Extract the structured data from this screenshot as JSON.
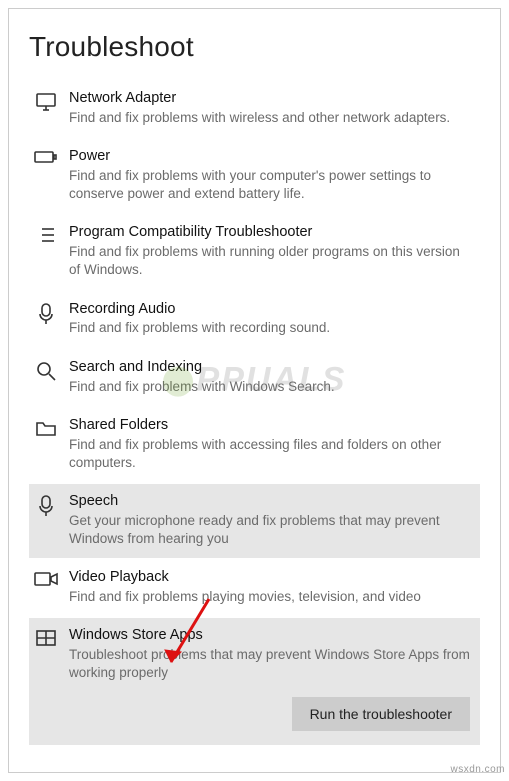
{
  "page": {
    "title": "Troubleshoot"
  },
  "items": [
    {
      "title": "Network Adapter",
      "desc": "Find and fix problems with wireless and other network adapters.",
      "icon": "monitor",
      "state": "normal"
    },
    {
      "title": "Power",
      "desc": "Find and fix problems with your computer's power settings to conserve power and extend battery life.",
      "icon": "battery",
      "state": "normal"
    },
    {
      "title": "Program Compatibility Troubleshooter",
      "desc": "Find and fix problems with running older programs on this version of Windows.",
      "icon": "list",
      "state": "normal"
    },
    {
      "title": "Recording Audio",
      "desc": "Find and fix problems with recording sound.",
      "icon": "mic",
      "state": "normal"
    },
    {
      "title": "Search and Indexing",
      "desc": "Find and fix problems with Windows Search.",
      "icon": "search",
      "state": "normal"
    },
    {
      "title": "Shared Folders",
      "desc": "Find and fix problems with accessing files and folders on other computers.",
      "icon": "folder",
      "state": "normal"
    },
    {
      "title": "Speech",
      "desc": "Get your microphone ready and fix problems that may prevent Windows from hearing you",
      "icon": "mic",
      "state": "selected"
    },
    {
      "title": "Video Playback",
      "desc": "Find and fix problems playing movies, television, and video",
      "icon": "video",
      "state": "normal"
    },
    {
      "title": "Windows Store Apps",
      "desc": "Troubleshoot problems that may prevent Windows Store Apps from working properly",
      "icon": "store",
      "state": "expanded"
    }
  ],
  "button": {
    "run_label": "Run the troubleshooter"
  },
  "watermark": "PPUALS",
  "credit": "wsxdn.com"
}
